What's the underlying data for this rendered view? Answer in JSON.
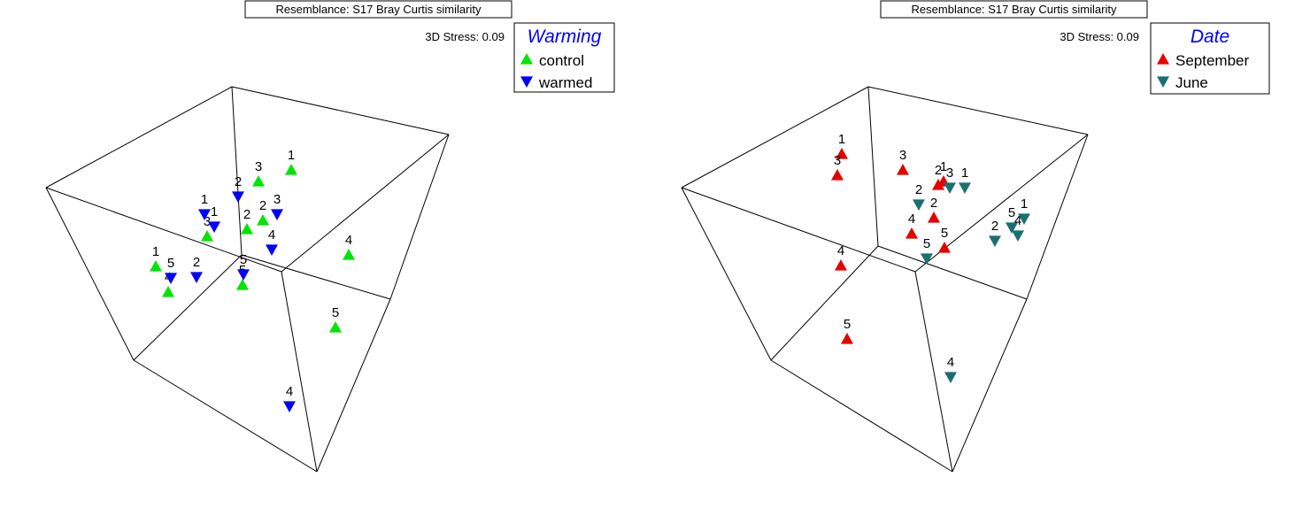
{
  "chart_data": [
    {
      "type": "scatter",
      "title": "Resemblance: S17 Bray Curtis similarity",
      "stress_label": "3D Stress: 0.09",
      "legend": {
        "title": "Warming",
        "title_color": "#0000ff",
        "entries": [
          {
            "label": "control",
            "marker": "triangle-up",
            "color": "#00e600"
          },
          {
            "label": "warmed",
            "marker": "triangle-down",
            "color": "#0000ff"
          }
        ]
      },
      "points": [
        {
          "label": "1",
          "group": "control",
          "pos": [
            329,
            192
          ]
        },
        {
          "label": "3",
          "group": "control",
          "pos": [
            292,
            205
          ]
        },
        {
          "label": "2",
          "group": "control",
          "pos": [
            297,
            249
          ]
        },
        {
          "label": "2",
          "group": "control",
          "pos": [
            279,
            259
          ]
        },
        {
          "label": "3",
          "group": "control",
          "pos": [
            234,
            267
          ]
        },
        {
          "label": "4",
          "group": "control",
          "pos": [
            394,
            288
          ]
        },
        {
          "label": "1",
          "group": "control",
          "pos": [
            176,
            301
          ]
        },
        {
          "label": "4",
          "group": "control",
          "pos": [
            190,
            330
          ]
        },
        {
          "label": "5",
          "group": "control",
          "pos": [
            274,
            322
          ]
        },
        {
          "label": "5",
          "group": "control",
          "pos": [
            379,
            370
          ]
        },
        {
          "label": "2",
          "group": "warmed",
          "pos": [
            269,
            222
          ]
        },
        {
          "label": "3",
          "group": "warmed",
          "pos": [
            313,
            242
          ]
        },
        {
          "label": "1",
          "group": "warmed",
          "pos": [
            231,
            242
          ]
        },
        {
          "label": "1",
          "group": "warmed",
          "pos": [
            242,
            256
          ]
        },
        {
          "label": "4",
          "group": "warmed",
          "pos": [
            307,
            282
          ]
        },
        {
          "label": "5",
          "group": "warmed",
          "pos": [
            193,
            314
          ]
        },
        {
          "label": "2",
          "group": "warmed",
          "pos": [
            222,
            313
          ]
        },
        {
          "label": "5",
          "group": "warmed",
          "pos": [
            275,
            310
          ]
        },
        {
          "label": "4",
          "group": "warmed",
          "pos": [
            327,
            459
          ]
        }
      ]
    },
    {
      "type": "scatter",
      "title": "Resemblance: S17 Bray Curtis similarity",
      "stress_label": "3D Stress: 0.09",
      "legend": {
        "title": "Date",
        "title_color": "#0000ff",
        "entries": [
          {
            "label": "September",
            "marker": "triangle-up",
            "color": "#e60000"
          },
          {
            "label": "June",
            "marker": "triangle-down",
            "color": "#1a7070"
          }
        ]
      },
      "points": [
        {
          "label": "1",
          "group": "September",
          "pos": [
            951,
            174
          ]
        },
        {
          "label": "3",
          "group": "September",
          "pos": [
            946,
            198
          ]
        },
        {
          "label": "3",
          "group": "September",
          "pos": [
            1020,
            192
          ]
        },
        {
          "label": "2",
          "group": "September",
          "pos": [
            1060,
            209
          ]
        },
        {
          "label": "1",
          "group": "September",
          "pos": [
            1066,
            205
          ]
        },
        {
          "label": "2",
          "group": "September",
          "pos": [
            1055,
            246
          ]
        },
        {
          "label": "4",
          "group": "September",
          "pos": [
            1030,
            264
          ]
        },
        {
          "label": "5",
          "group": "September",
          "pos": [
            1067,
            280
          ]
        },
        {
          "label": "4",
          "group": "September",
          "pos": [
            950,
            300
          ]
        },
        {
          "label": "5",
          "group": "September",
          "pos": [
            957,
            383
          ]
        },
        {
          "label": "3",
          "group": "June",
          "pos": [
            1073,
            212
          ]
        },
        {
          "label": "1",
          "group": "June",
          "pos": [
            1090,
            212
          ]
        },
        {
          "label": "2",
          "group": "June",
          "pos": [
            1038,
            231
          ]
        },
        {
          "label": "1",
          "group": "June",
          "pos": [
            1157,
            247
          ]
        },
        {
          "label": "5",
          "group": "June",
          "pos": [
            1143,
            257
          ]
        },
        {
          "label": "4",
          "group": "June",
          "pos": [
            1150,
            266
          ]
        },
        {
          "label": "2",
          "group": "June",
          "pos": [
            1124,
            272
          ]
        },
        {
          "label": "5",
          "group": "June",
          "pos": [
            1047,
            292
          ]
        },
        {
          "label": "4",
          "group": "June",
          "pos": [
            1074,
            426
          ]
        }
      ]
    }
  ]
}
